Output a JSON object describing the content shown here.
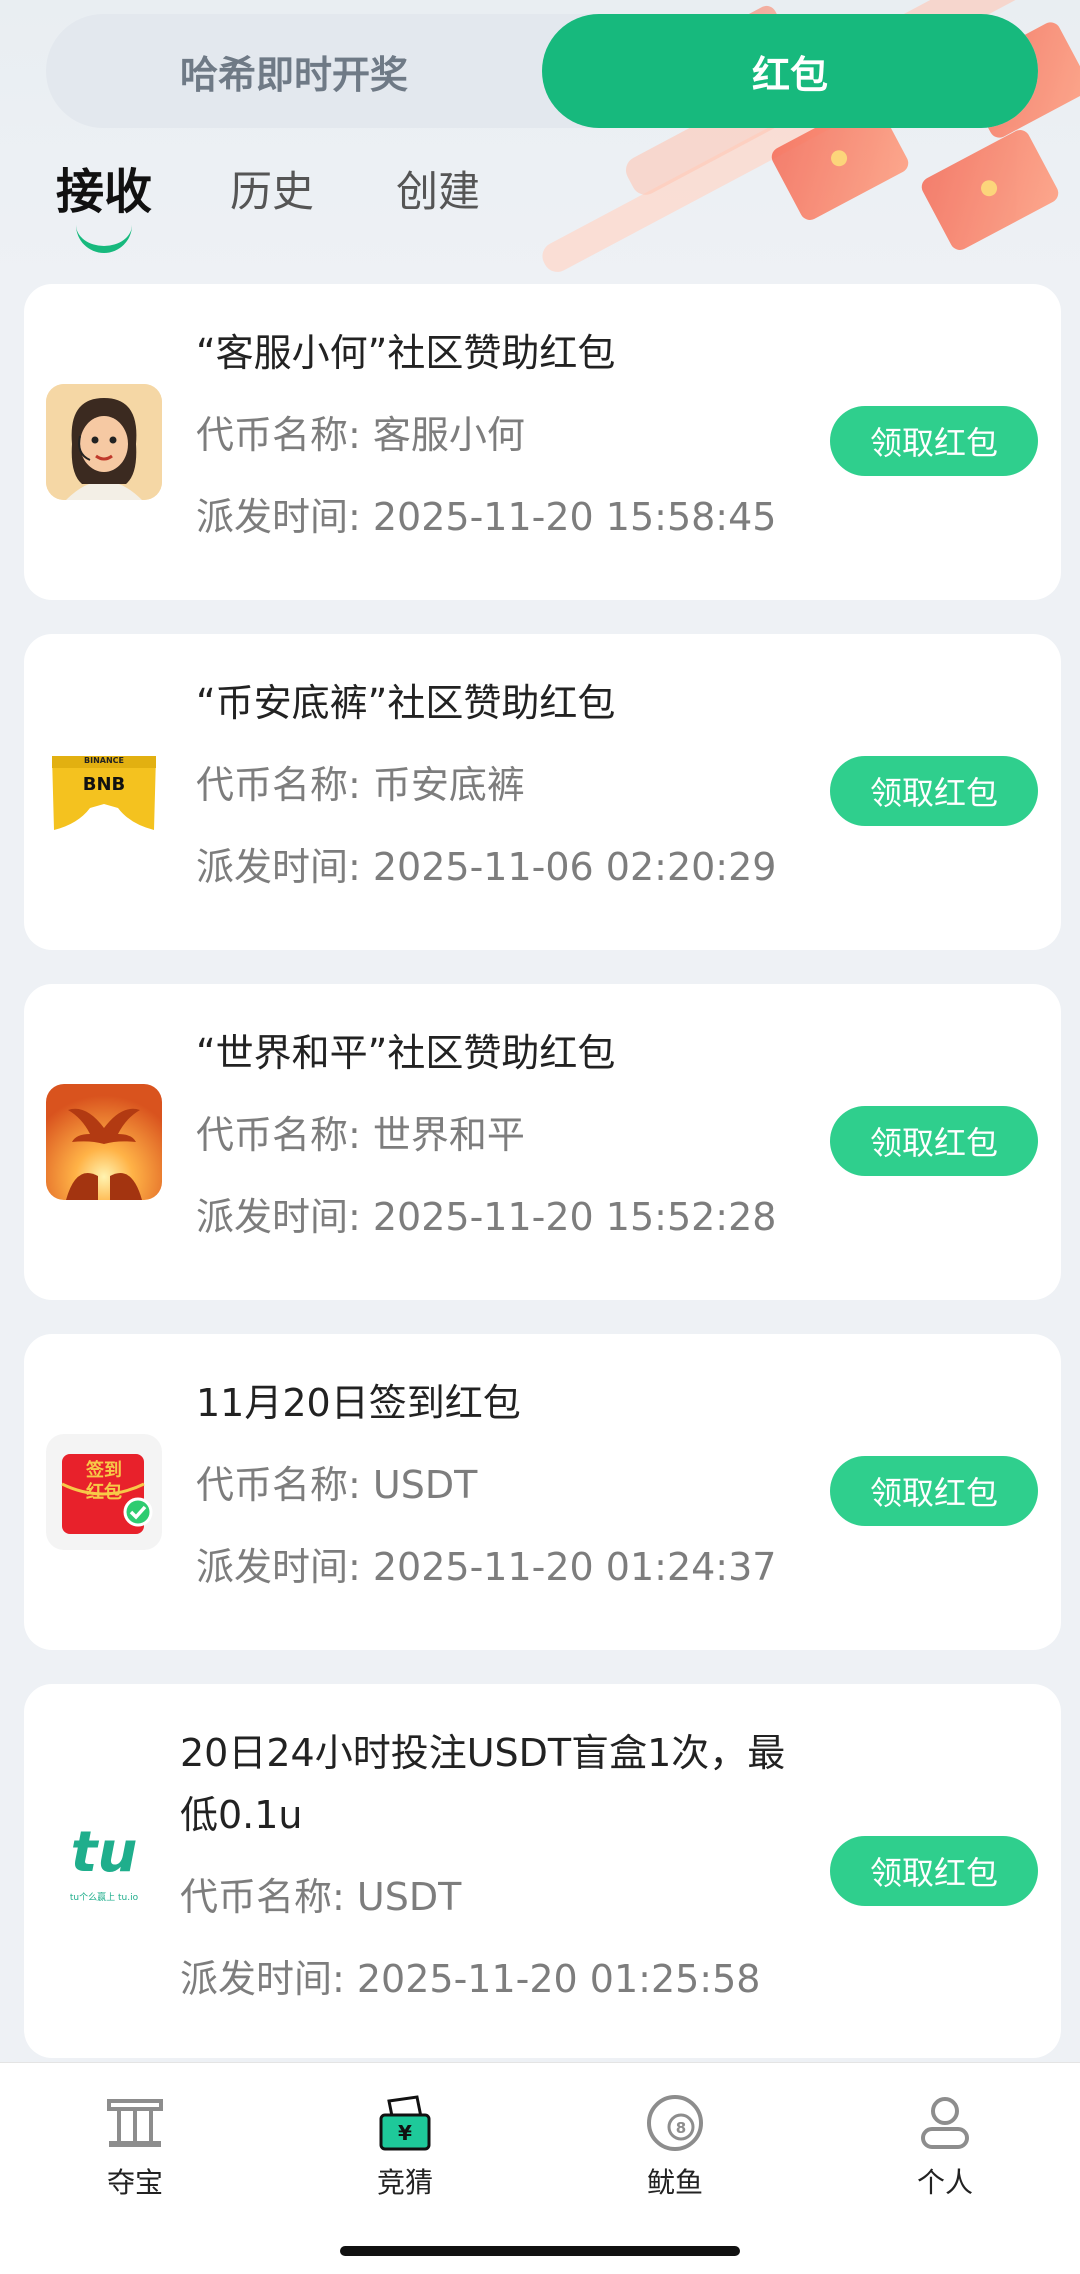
{
  "segment": {
    "left_label": "哈希即时开奖",
    "right_label": "红包",
    "active": "红包"
  },
  "subtabs": [
    {
      "label": "接收",
      "active": true
    },
    {
      "label": "历史",
      "active": false
    },
    {
      "label": "创建",
      "active": false
    }
  ],
  "cards": [
    {
      "title": "“客服小何”社区赞助红包",
      "token_line": "代币名称: 客服小何",
      "time_line": "派发时间: 2025-11-20 15:58:45",
      "button": "领取红包",
      "icon": "cartoon-avatar-icon"
    },
    {
      "title": "“币安底裤”社区赞助红包",
      "token_line": "代币名称: 币安底裤",
      "time_line": "派发时间: 2025-11-06 02:20:29",
      "button": "领取红包",
      "icon": "bnb-shorts-icon",
      "icon_text": "BNB",
      "icon_brand": "BINANCE"
    },
    {
      "title": "“世界和平”社区赞助红包",
      "token_line": "代币名称: 世界和平",
      "time_line": "派发时间: 2025-11-20 15:52:28",
      "button": "领取红包",
      "icon": "peace-dove-icon"
    },
    {
      "title": "11月20日签到红包",
      "token_line": "代币名称: USDT",
      "time_line": "派发时间: 2025-11-20 01:24:37",
      "button": "领取红包",
      "icon": "checkin-red-envelope-icon",
      "icon_text": "签到红包"
    },
    {
      "title_line1": "20日24小时投注USDT盲盒1次，最",
      "title_line2": "低0.1u",
      "token_line": "代币名称: USDT",
      "time_line": "派发时间: 2025-11-20 01:25:58",
      "button": "领取红包",
      "icon": "tu-logo-icon",
      "icon_text": "tu",
      "icon_caption": "tu个么赢上 tu.io"
    }
  ],
  "bottom_nav": [
    {
      "label": "夺宝",
      "icon": "treasure-pillar-icon"
    },
    {
      "label": "竞猜",
      "icon": "ballot-box-icon"
    },
    {
      "label": "鱿鱼",
      "icon": "eight-ball-icon"
    },
    {
      "label": "个人",
      "icon": "person-icon"
    }
  ],
  "colors": {
    "accent": "#17b97d",
    "button": "#2fcf8d",
    "background": "#eef1f5"
  }
}
